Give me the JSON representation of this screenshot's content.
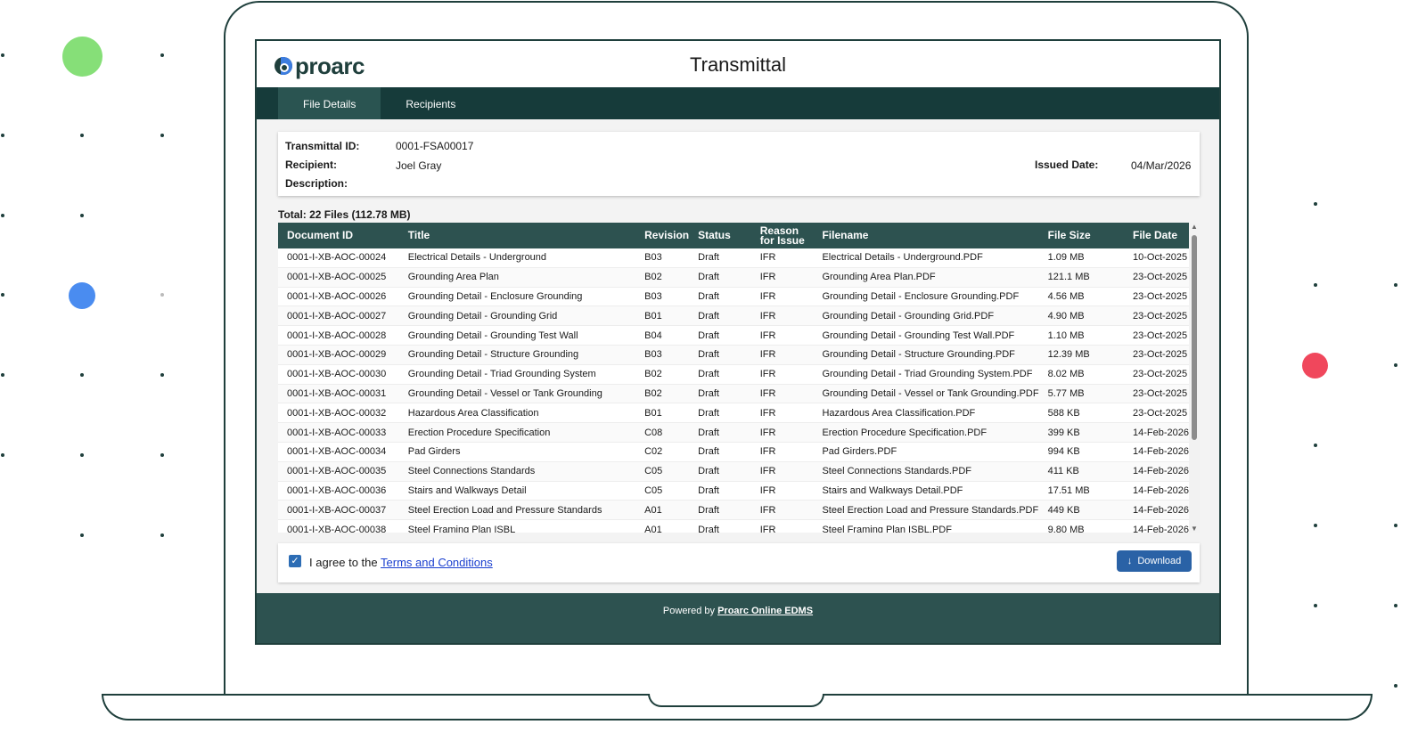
{
  "page": {
    "title": "Transmittal",
    "logo_text": "proarc",
    "tabs": [
      "File Details",
      "Recipients"
    ]
  },
  "details": {
    "transmittal_id_label": "Transmittal ID:",
    "transmittal_id": "0001-FSA00017",
    "recipient_label": "Recipient:",
    "recipient": "Joel Gray",
    "description_label": "Description:",
    "issued_date_label": "Issued Date:",
    "issued_date": "04/Mar/2026"
  },
  "total_label": "Total: 22 Files (112.78 MB)",
  "table": {
    "columns": [
      "Document ID",
      "Title",
      "Revision",
      "Status",
      "Reason for Issue",
      "Filename",
      "File Size",
      "File Date"
    ],
    "rows": [
      [
        "0001-I-XB-AOC-00024",
        "Electrical Details - Underground",
        "B03",
        "Draft",
        "IFR",
        "Electrical Details - Underground.PDF",
        "1.09 MB",
        "10-Oct-2025"
      ],
      [
        "0001-I-XB-AOC-00025",
        "Grounding Area Plan",
        "B02",
        "Draft",
        "IFR",
        "Grounding Area Plan.PDF",
        "121.1 MB",
        "23-Oct-2025"
      ],
      [
        "0001-I-XB-AOC-00026",
        "Grounding Detail - Enclosure Grounding",
        "B03",
        "Draft",
        "IFR",
        "Grounding Detail - Enclosure Grounding.PDF",
        "4.56 MB",
        "23-Oct-2025"
      ],
      [
        "0001-I-XB-AOC-00027",
        "Grounding Detail - Grounding Grid",
        "B01",
        "Draft",
        "IFR",
        "Grounding Detail - Grounding Grid.PDF",
        "4.90 MB",
        "23-Oct-2025"
      ],
      [
        "0001-I-XB-AOC-00028",
        "Grounding Detail - Grounding Test Wall",
        "B04",
        "Draft",
        "IFR",
        "Grounding Detail - Grounding Test Wall.PDF",
        "1.10 MB",
        "23-Oct-2025"
      ],
      [
        "0001-I-XB-AOC-00029",
        "Grounding Detail - Structure Grounding",
        "B03",
        "Draft",
        "IFR",
        "Grounding Detail - Structure Grounding.PDF",
        "12.39 MB",
        "23-Oct-2025"
      ],
      [
        "0001-I-XB-AOC-00030",
        "Grounding Detail - Triad Grounding System",
        "B02",
        "Draft",
        "IFR",
        "Grounding Detail - Triad Grounding System.PDF",
        "8.02 MB",
        "23-Oct-2025"
      ],
      [
        "0001-I-XB-AOC-00031",
        "Grounding Detail - Vessel or Tank Grounding",
        "B02",
        "Draft",
        "IFR",
        "Grounding Detail - Vessel or Tank Grounding.PDF",
        "5.77 MB",
        "23-Oct-2025"
      ],
      [
        "0001-I-XB-AOC-00032",
        "Hazardous Area Classification",
        "B01",
        "Draft",
        "IFR",
        "Hazardous Area Classification.PDF",
        "588 KB",
        "23-Oct-2025"
      ],
      [
        "0001-I-XB-AOC-00033",
        "Erection Procedure Specification",
        "C08",
        "Draft",
        "IFR",
        "Erection Procedure Specification.PDF",
        "399 KB",
        "14-Feb-2026"
      ],
      [
        "0001-I-XB-AOC-00034",
        "Pad Girders",
        "C02",
        "Draft",
        "IFR",
        "Pad Girders.PDF",
        "994 KB",
        "14-Feb-2026"
      ],
      [
        "0001-I-XB-AOC-00035",
        "Steel Connections Standards",
        "C05",
        "Draft",
        "IFR",
        "Steel Connections Standards.PDF",
        "411 KB",
        "14-Feb-2026"
      ],
      [
        "0001-I-XB-AOC-00036",
        "Stairs and Walkways Detail",
        "C05",
        "Draft",
        "IFR",
        "Stairs and Walkways Detail.PDF",
        "17.51 MB",
        "14-Feb-2026"
      ],
      [
        "0001-I-XB-AOC-00037",
        "Steel Erection Load and Pressure Standards",
        "A01",
        "Draft",
        "IFR",
        "Steel Erection Load and Pressure Standards.PDF",
        "449 KB",
        "14-Feb-2026"
      ],
      [
        "0001-I-XB-AOC-00038",
        "Steel Framing Plan ISBL",
        "A01",
        "Draft",
        "IFR",
        "Steel Framing Plan ISBL.PDF",
        "9.80 MB",
        "14-Feb-2026"
      ]
    ]
  },
  "agree": {
    "prefix": "I agree to the",
    "link": "Terms and Conditions",
    "checked": true
  },
  "download_label": "Download",
  "footer": {
    "prefix": "Powered by",
    "link": "Proarc Online EDMS"
  },
  "colors": {
    "brand_dark": "#163b3a",
    "header_row": "#2d5250",
    "accent_blue": "#2a62a6",
    "bubble_green": "#86df78",
    "bubble_blue": "#4a8cf0",
    "bubble_red": "#f0475c"
  },
  "icons": {
    "checkbox": "check-icon",
    "download": "download-arrow-icon",
    "logo": "proarc-logo-icon"
  }
}
